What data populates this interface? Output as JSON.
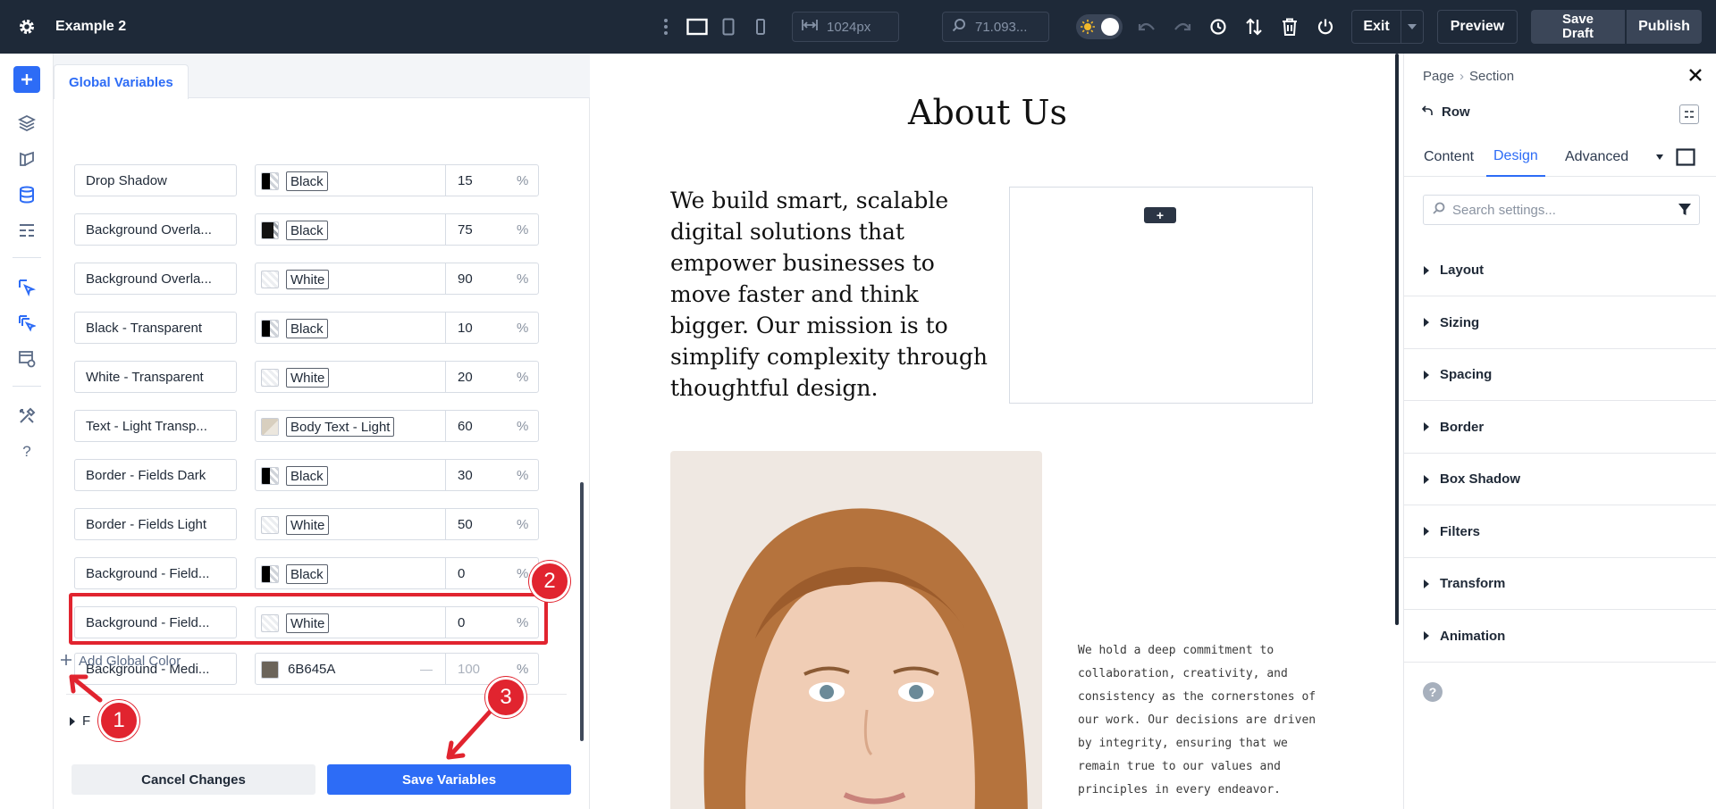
{
  "window": {
    "title": "Example 2"
  },
  "toolbar": {
    "width_value": "1024px",
    "zoom_value": "71.093...",
    "exit_label": "Exit",
    "preview_label": "Preview",
    "save_draft_line1": "Save",
    "save_draft_line2": "Draft",
    "publish_label": "Publish"
  },
  "variables_panel": {
    "tab_label": "Global Variables",
    "rows": [
      {
        "name": "Drop Shadow",
        "color_label": "Black",
        "opacity": "15",
        "swatch": "#000000",
        "pattern": "half"
      },
      {
        "name": "Background Overla...",
        "color_label": "Black",
        "opacity": "75",
        "swatch": "#000000",
        "pattern": "mostly"
      },
      {
        "name": "Background Overla...",
        "color_label": "White",
        "opacity": "90",
        "swatch": "#ffffff",
        "pattern": "light"
      },
      {
        "name": "Black - Transparent",
        "color_label": "Black",
        "opacity": "10",
        "swatch": "#000000",
        "pattern": "half"
      },
      {
        "name": "White - Transparent",
        "color_label": "White",
        "opacity": "20",
        "swatch": "#ffffff",
        "pattern": "light"
      },
      {
        "name": "Text - Light Transp...",
        "color_label": "Body Text - Light",
        "opacity": "60",
        "swatch": "#d8cfbf",
        "pattern": "tan"
      },
      {
        "name": "Border - Fields Dark",
        "color_label": "Black",
        "opacity": "30",
        "swatch": "#000000",
        "pattern": "half"
      },
      {
        "name": "Border - Fields Light",
        "color_label": "White",
        "opacity": "50",
        "swatch": "#ffffff",
        "pattern": "light"
      },
      {
        "name": "Background - Field...",
        "color_label": "Black",
        "opacity": "0",
        "swatch": "#000000",
        "pattern": "half"
      },
      {
        "name": "Background - Field...",
        "color_label": "White",
        "opacity": "0",
        "swatch": "#ffffff",
        "pattern": "light"
      }
    ],
    "new_row": {
      "name": "Background - Medi...",
      "hex": "6B645A",
      "dash": "—",
      "opacity": "100",
      "swatch": "#6B645A"
    },
    "percent_sign": "%",
    "add_color_label": "Add Global Color",
    "collapsed_group_label": "F",
    "cancel_label": "Cancel Changes",
    "save_label": "Save Variables"
  },
  "canvas": {
    "title": "About Us",
    "hero_text": "We build smart, scalable digital solutions that empower businesses to move faster and think bigger. Our mission is to simplify complexity through thoughtful design.",
    "add_module_label": "+",
    "body_copy": "We hold a deep commitment to collaboration, creativity, and consistency as the cornerstones of our work. Our decisions are driven by integrity, ensuring that we remain true to our values and principles in every endeavor."
  },
  "settings_panel": {
    "breadcrumb": [
      "Page",
      "Section"
    ],
    "element_label": "Row",
    "tabs": [
      "Content",
      "Design",
      "Advanced"
    ],
    "active_tab": "Design",
    "search_placeholder": "Search settings...",
    "groups": [
      "Layout",
      "Sizing",
      "Spacing",
      "Border",
      "Box Shadow",
      "Filters",
      "Transform",
      "Animation"
    ],
    "help_label": "?"
  },
  "annotations": {
    "markers": [
      "1",
      "2",
      "3"
    ],
    "color": "#e1242f"
  },
  "colors": {
    "topbar": "#1e2938",
    "accent": "#2d6cf6"
  }
}
